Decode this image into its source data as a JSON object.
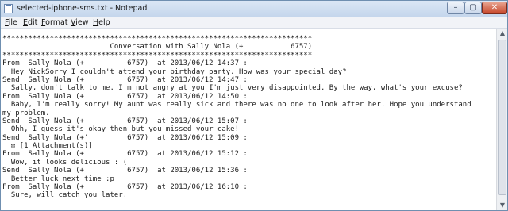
{
  "window": {
    "title": "selected-iphone-sms.txt - Notepad"
  },
  "controls": {
    "minimize": "–",
    "maximize": "▢",
    "close": "✕"
  },
  "menu": {
    "file": "File",
    "edit": "Edit",
    "format": "Format",
    "view": "View",
    "help": "Help"
  },
  "scrollbar": {
    "up": "▲",
    "down": "▼"
  },
  "document": {
    "lines": [
      "************************************************************************",
      "                         Conversation with Sally Nola (+           6757)",
      "************************************************************************",
      "From  Sally Nola (+          6757)  at 2013/06/12 14:37 :",
      "  Hey NickSorry I couldn't attend your birthday party. How was your special day?",
      "Send  Sally Nola (+          6757)  at 2013/06/12 14:47 :",
      "  Sally, don't talk to me. I'm not angry at you I'm just very disappointed. By the way, what's your excuse?",
      "From  Sally Nola (+          6757)  at 2013/06/12 14:50 :",
      "  Baby, I'm really sorry! My aunt was really sick and there was no one to look after her. Hope you understand",
      "my problem.",
      "Send  Sally Nola (+          6757)  at 2013/06/12 15:07 :",
      "  Ohh, I guess it's okay then but you missed your cake!",
      "Send  Sally Nola (+'         6757)  at 2013/06/12 15:09 :",
      "  ✉ [1 Attachment(s)]",
      "From  Sally Nola (+          6757)  at 2013/06/12 15:12 :",
      "  Wow, it looks delicious : (",
      "Send  Sally Nola (+          6757)  at 2013/06/12 15:36 :",
      "  Better luck next time :p",
      "From  Sally Nola (+          6757)  at 2013/06/12 16:10 :",
      "  Sure, will catch you later."
    ]
  }
}
